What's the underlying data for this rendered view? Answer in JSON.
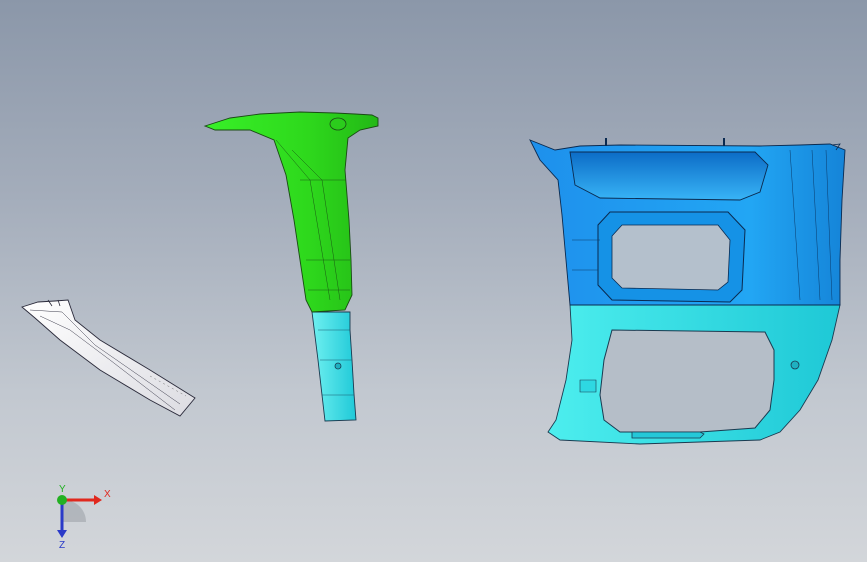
{
  "viewport": {
    "background_top": "#8b97a9",
    "background_bottom": "#d3d6da"
  },
  "parts": [
    {
      "name": "trim-strip",
      "color": "#f4f4f6"
    },
    {
      "name": "b-pillar-trim",
      "color_upper": "#2ee81a",
      "color_lower": "#35e6e6"
    },
    {
      "name": "door-panel-trim",
      "color_upper": "#1a9ef2",
      "color_lower": "#2ee0e6"
    }
  ],
  "triad": {
    "x_label": "X",
    "y_label": "Y",
    "z_label": "Z",
    "x_color": "#e0281e",
    "y_color": "#22b022",
    "z_color": "#2a3ac8"
  }
}
